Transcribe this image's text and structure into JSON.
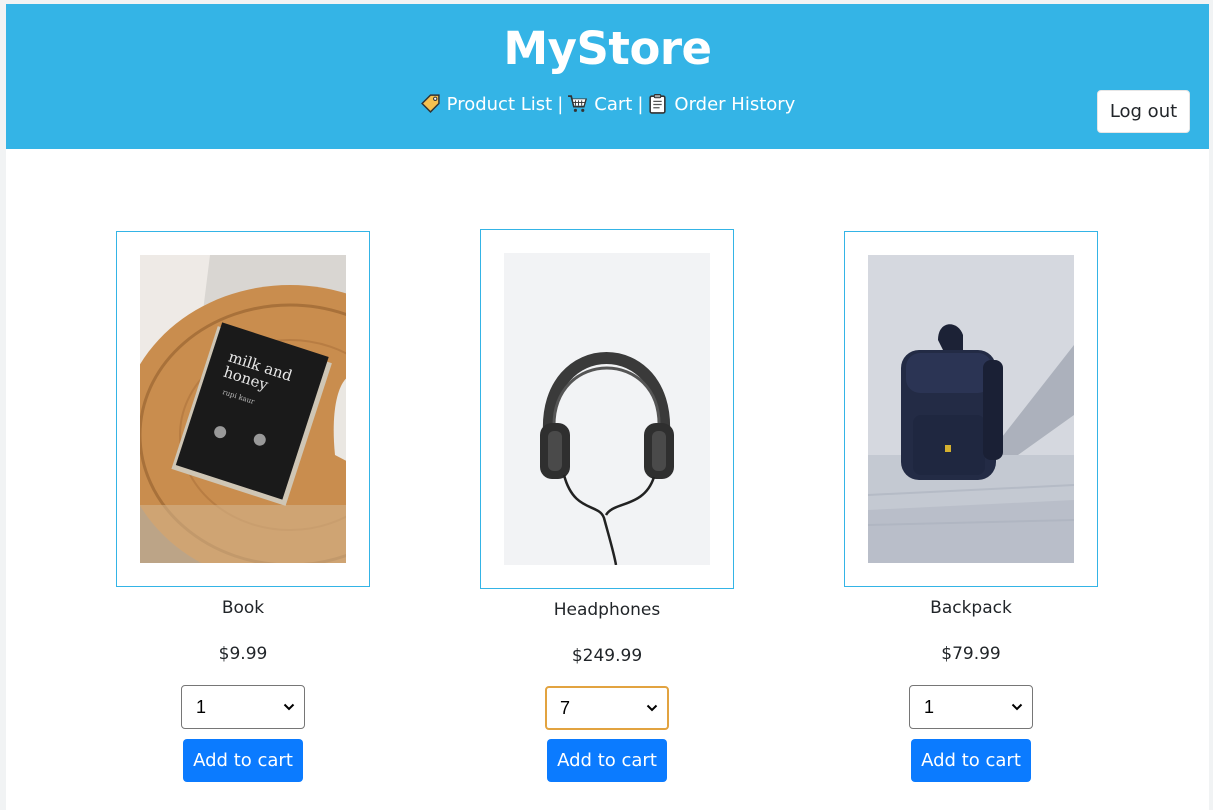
{
  "header": {
    "brand": "MyStore",
    "nav": [
      {
        "icon": "price-tag-icon",
        "label": "Product List"
      },
      {
        "icon": "shopping-cart-icon",
        "label": "Cart"
      },
      {
        "icon": "clipboard-icon",
        "label": "Order History"
      }
    ],
    "separator": "|",
    "logout_label": "Log out"
  },
  "colors": {
    "header_bg": "#34b4e6",
    "button_bg": "#0b7bff",
    "card_border": "#34b4e6",
    "select_focus": "#e2a340"
  },
  "products": [
    {
      "name": "Book",
      "price": "$9.99",
      "quantity": "1",
      "button": "Add to cart",
      "image_icon": "book-photo"
    },
    {
      "name": "Headphones",
      "price": "$249.99",
      "quantity": "7",
      "button": "Add to cart",
      "image_icon": "headphones-photo"
    },
    {
      "name": "Backpack",
      "price": "$79.99",
      "quantity": "1",
      "button": "Add to cart",
      "image_icon": "backpack-photo"
    }
  ]
}
